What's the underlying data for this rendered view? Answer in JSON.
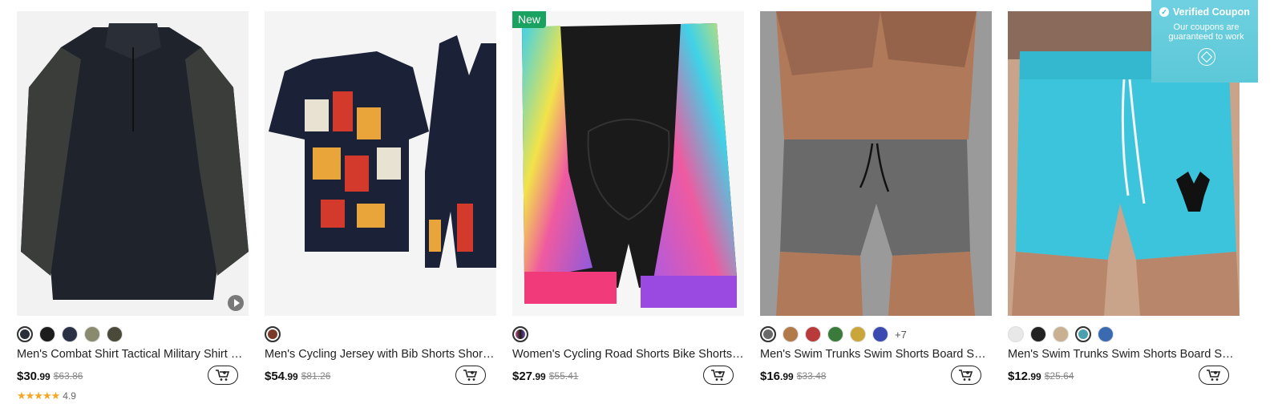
{
  "products": [
    {
      "title": "Men's Combat Shirt Tactical Military Shirt Long Sleeve Camouflage Quick Dry",
      "currency": "$",
      "price_int": "30",
      "price_dec": ".99",
      "was": "$63.86",
      "rating_stars": "★★★★★",
      "rating": "4.9",
      "badge": "",
      "has_video": true,
      "swatches": [
        "#2b2f38",
        "#1c1c1c",
        "#2a3145",
        "#8a8a6e",
        "#4a4a3a"
      ],
      "more": ""
    },
    {
      "title": "Men's Cycling Jersey with Bib Shorts Short Sleeve Mountain Bike",
      "currency": "$",
      "price_int": "54",
      "price_dec": ".99",
      "was": "$81.26",
      "rating_stars": "",
      "rating": "",
      "badge": "",
      "has_video": false,
      "swatches": [
        "#7a3b2a"
      ],
      "more": ""
    },
    {
      "title": "Women's Cycling Road Shorts Bike Shorts Padded Tie Dye",
      "currency": "$",
      "price_int": "27",
      "price_dec": ".99",
      "was": "$55.41",
      "rating_stars": "",
      "rating": "",
      "badge": "New",
      "has_video": false,
      "swatches": [
        "#1c1c1c"
      ],
      "more": ""
    },
    {
      "title": "Men's Swim Trunks Swim Shorts Board Shorts Drawstring Elastic Waist",
      "currency": "$",
      "price_int": "16",
      "price_dec": ".99",
      "was": "$33.48",
      "rating_stars": "",
      "rating": "",
      "badge": "",
      "has_video": false,
      "swatches": [
        "#6a6a6a",
        "#b07a4a",
        "#b83a3a",
        "#3a7a3a",
        "#c9a53a",
        "#3a4ab0"
      ],
      "more": "+7"
    },
    {
      "title": "Men's Swim Trunks Swim Shorts Board Shorts Deer Print",
      "currency": "$",
      "price_int": "12",
      "price_dec": ".99",
      "was": "$25.64",
      "rating_stars": "",
      "rating": "",
      "badge": "",
      "has_video": false,
      "swatches": [
        "#e8e8e8",
        "#222222",
        "#c8b090",
        "#4aa0b0",
        "#3a6ab0"
      ],
      "more": ""
    }
  ],
  "coupon": {
    "title": "Verified Coupon",
    "line1": "Our coupons are",
    "line2": "guaranteed to work",
    "check": "✓"
  }
}
